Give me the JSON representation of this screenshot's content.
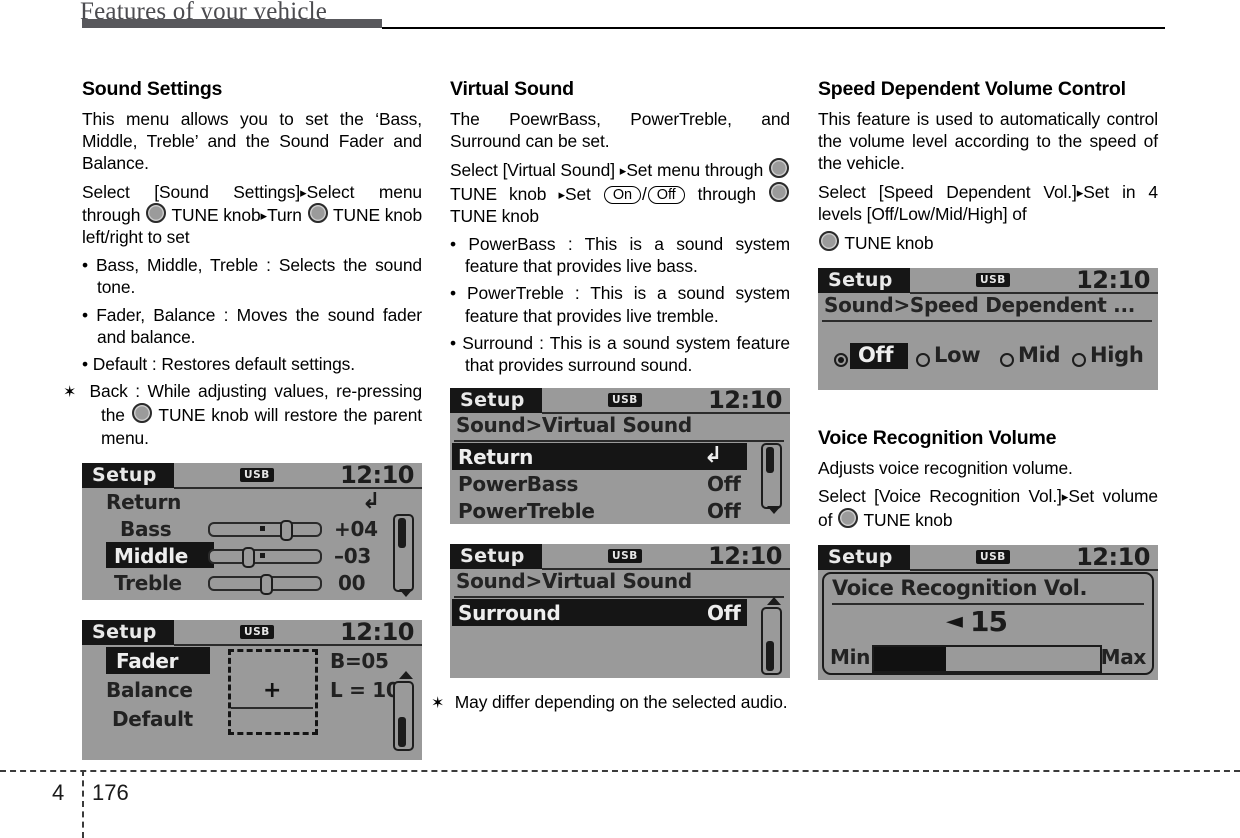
{
  "header": {
    "title": "Features of your vehicle"
  },
  "footer": {
    "chapter": "4",
    "page": "176"
  },
  "col1": {
    "heading": "Sound Settings",
    "para1": "This menu allows you to set the ‘Bass, Middle, Treble’ and the Sound Fader and Balance.",
    "instr": {
      "p1": "Select   [Sound   Settings]",
      "p2": "Select menu  through",
      "p3": "TUNE  knob",
      "p4": "Turn",
      "p5": "TUNE knob left/right to set"
    },
    "bullets": [
      "Bass, Middle, Treble : Selects the sound tone.",
      "Fader, Balance : Moves the sound fader and balance.",
      "Default : Restores default settings."
    ],
    "note": {
      "pre": "Back : While adjusting values, re-pressing  the",
      "post": "TUNE  knob  will restore the parent menu."
    },
    "lcd_sound": {
      "tab": "Setup",
      "usb": "USB",
      "clock": "12:10",
      "rows": [
        {
          "label": "Return",
          "value": ""
        },
        {
          "label": "Bass",
          "value": "+04"
        },
        {
          "label": "Middle",
          "value": "–03"
        },
        {
          "label": "Treble",
          "value": "00"
        }
      ]
    },
    "lcd_fader": {
      "tab": "Setup",
      "usb": "USB",
      "clock": "12:10",
      "rows": [
        {
          "label": "Fader"
        },
        {
          "label": "Balance"
        },
        {
          "label": "Default"
        }
      ],
      "balance_value": "B=05",
      "fader_value": "L = 10",
      "pad_marker": "+"
    }
  },
  "col2": {
    "heading": "Virtual Sound",
    "para1": "The PoewrBass, PowerTreble, and Surround can be set.",
    "instr": {
      "p1": "Select  [Virtual  Sound]",
      "p2": "Set  menu through",
      "p3": "TUNE  knob",
      "p4": "Set",
      "on": "On",
      "off": "Off",
      "p5": "through",
      "p6": "TUNE knob"
    },
    "bullets": [
      "PowerBass : This is a sound system feature that provides live bass.",
      "PowerTreble : This is a sound system feature that provides live tremble.",
      "Surround : This is a sound system feature that provides surround sound."
    ],
    "lcd_virtual": {
      "tab": "Setup",
      "usb": "USB",
      "clock": "12:10",
      "breadcrumb": "Sound>Virtual Sound",
      "rows": [
        {
          "label": "Return",
          "value": ""
        },
        {
          "label": "PowerBass",
          "value": "Off"
        },
        {
          "label": "PowerTreble",
          "value": "Off"
        }
      ]
    },
    "lcd_surround": {
      "tab": "Setup",
      "usb": "USB",
      "clock": "12:10",
      "breadcrumb": "Sound>Virtual Sound",
      "rows": [
        {
          "label": "Surround",
          "value": "Off"
        }
      ]
    },
    "note": "May differ depending on the selected audio."
  },
  "col3": {
    "heading1": "Speed Dependent Volume Control",
    "para1": "This feature is used to automatically control the volume level according to the speed of the vehicle.",
    "instr1": {
      "p1": "Select [Speed  Dependent Vol.]",
      "p2": "Set in 4 levels [Off/Low/Mid/High] of",
      "p3": "TUNE knob"
    },
    "lcd_speed": {
      "tab": "Setup",
      "usb": "USB",
      "clock": "12:10",
      "breadcrumb": "Sound>Speed Dependent ...",
      "options": [
        {
          "label": "Off",
          "selected": true
        },
        {
          "label": "Low",
          "selected": false
        },
        {
          "label": "Mid",
          "selected": false
        },
        {
          "label": "High",
          "selected": false
        }
      ]
    },
    "heading2": "Voice Recognition Volume",
    "para2": "Adjusts voice recognition volume.",
    "instr2": {
      "p1": "Select  [Voice  Recognition  Vol.]",
      "p2": "Set volume of",
      "p3": "TUNE knob"
    },
    "lcd_voice": {
      "tab": "Setup",
      "usb": "USB",
      "clock": "12:10",
      "title": "Voice Recognition Vol.",
      "value": "15",
      "min_label": "Min",
      "max_label": "Max",
      "fill_percent": 32
    }
  },
  "colors": {
    "header_bar": "#58585c",
    "lcd_bg": "#9a9a9a",
    "lcd_dark": "#151515"
  }
}
